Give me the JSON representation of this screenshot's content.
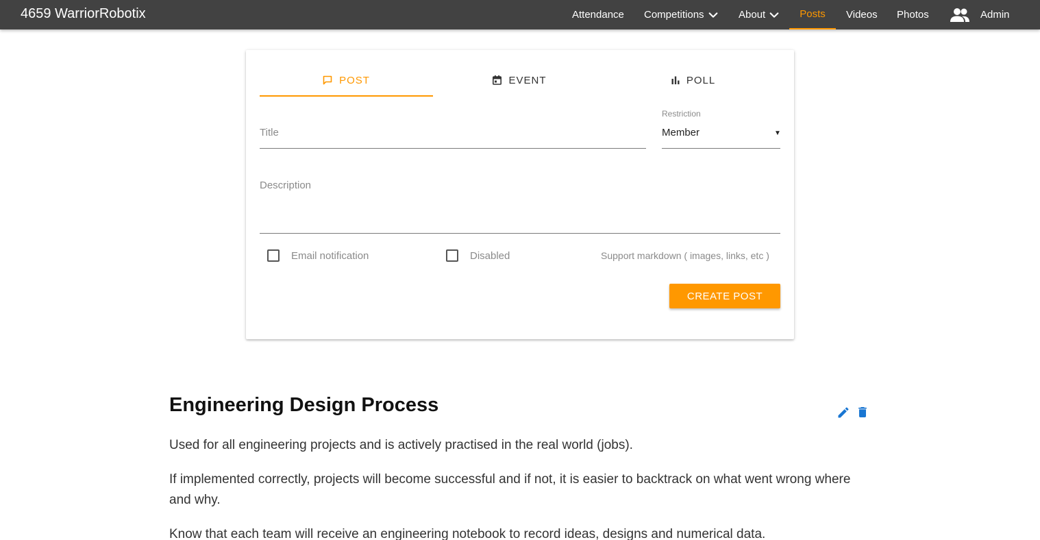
{
  "brand": "4659 WarriorRobotix",
  "nav": {
    "attendance": "Attendance",
    "competitions": "Competitions",
    "about": "About",
    "posts": "Posts",
    "videos": "Videos",
    "photos": "Photos",
    "admin": "Admin"
  },
  "tabs": {
    "post": "POST",
    "event": "EVENT",
    "poll": "POLL",
    "active": "post"
  },
  "form": {
    "title_placeholder": "Title",
    "restriction_label": "Restriction",
    "restriction_value": "Member",
    "description_placeholder": "Description",
    "email_notification_label": "Email notification",
    "email_notification_checked": false,
    "disabled_label": "Disabled",
    "disabled_checked": false,
    "markdown_hint": "Support markdown ( images, links, etc )",
    "create_button": "CREATE POST"
  },
  "post": {
    "title": "Engineering Design Process",
    "paragraphs": [
      "Used for all engineering projects and is actively practised in the real world (jobs).",
      "If implemented correctly, projects will become successful and if not, it is easier to backtrack on what went wrong where and why.",
      "Know that each team will receive an engineering notebook to record ideas, designs and numerical data."
    ]
  },
  "colors": {
    "navbar": "#424242",
    "accent": "#ff9800",
    "action_icons": "#1976d2"
  }
}
